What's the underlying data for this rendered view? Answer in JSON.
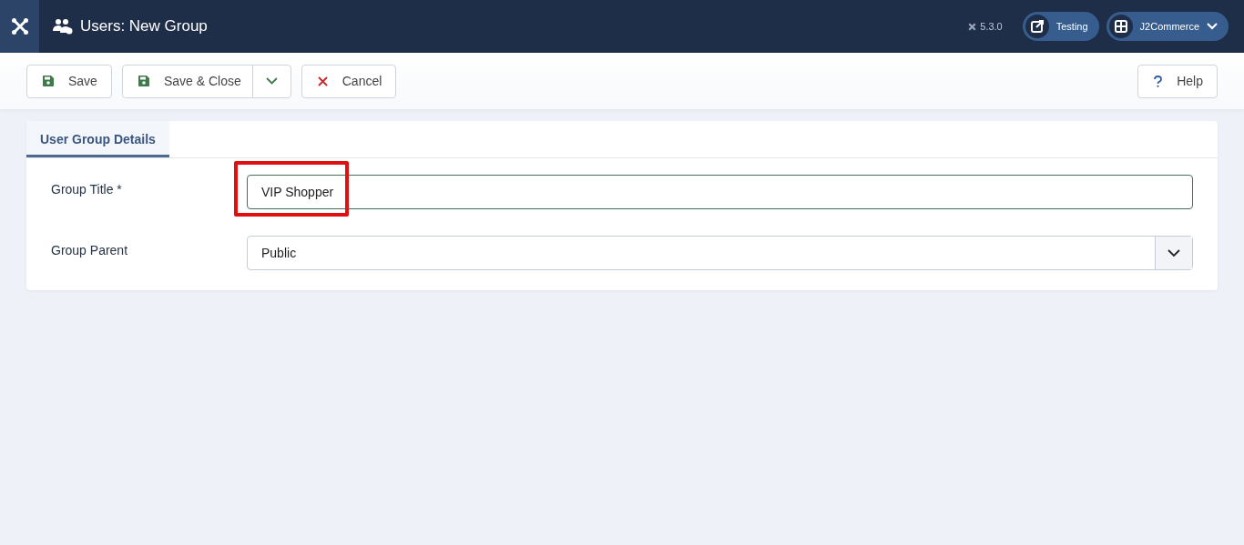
{
  "header": {
    "title": "Users: New Group",
    "version": "5.3.0",
    "site_button": "Testing",
    "user_menu": "J2Commerce"
  },
  "toolbar": [
    {
      "kind": "save",
      "label": "Save"
    },
    {
      "kind": "save-split",
      "label": "Save & Close"
    },
    {
      "kind": "cancel",
      "label": "Cancel"
    },
    {
      "kind": "help",
      "label": "Help"
    }
  ],
  "tabs": [
    {
      "label": "User Group Details",
      "selected": true
    }
  ],
  "fields": [
    {
      "kind": "text",
      "label": "Group Title *",
      "value": "VIP Shopper",
      "highlighted": true
    },
    {
      "kind": "select",
      "label": "Group Parent",
      "value": "Public",
      "highlighted": false
    }
  ]
}
